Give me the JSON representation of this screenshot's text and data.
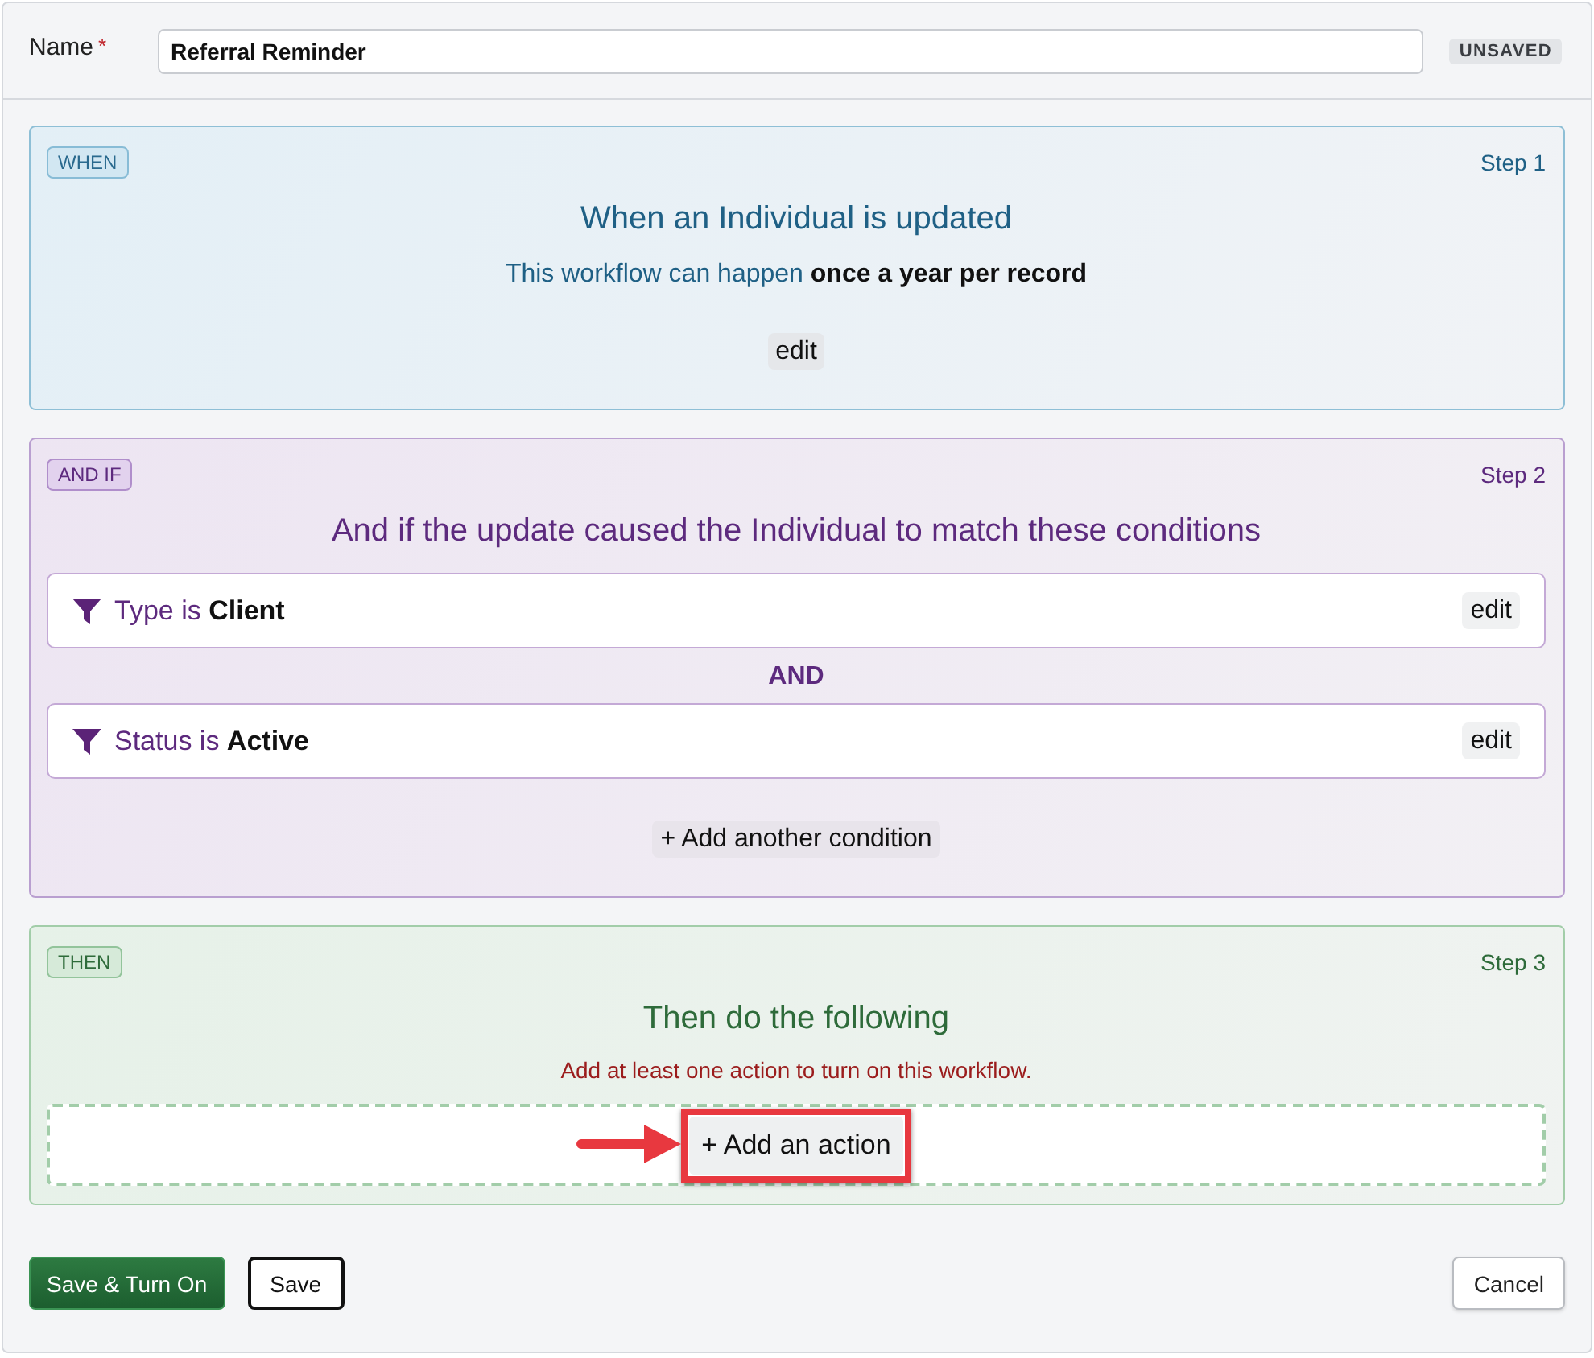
{
  "header": {
    "name_label": "Name",
    "required_mark": "*",
    "name_value": "Referral Reminder",
    "status_badge": "UNSAVED"
  },
  "steps": [
    {
      "kind": "when",
      "badge": "WHEN",
      "step_label": "Step 1",
      "title": "When an Individual is updated",
      "subtitle": "This workflow can happen **once a year per record**",
      "edit_button": "edit"
    },
    {
      "kind": "and_if",
      "badge": "AND IF",
      "step_label": "Step 2",
      "title": "And if the update caused the Individual to match these conditions",
      "conditions": [
        {
          "text": "Type is **Client**",
          "edit_button": "edit"
        },
        {
          "joiner": "AND",
          "text": "Status is **Active**",
          "edit_button": "edit"
        }
      ],
      "add_button": "+ Add another condition"
    },
    {
      "kind": "then",
      "badge": "THEN",
      "step_label": "Step 3",
      "title": "Then do the following",
      "warning": "Add at least one action to turn on this workflow.",
      "action_button": {
        "label": "+ Add an action",
        "highlighted": true
      }
    }
  ],
  "footer": {
    "buttons": [
      {
        "kind": "primary",
        "label": "Save & Turn On"
      },
      {
        "kind": "secondary",
        "label": "Save"
      },
      {
        "kind": "cancel",
        "label": "Cancel"
      }
    ]
  }
}
